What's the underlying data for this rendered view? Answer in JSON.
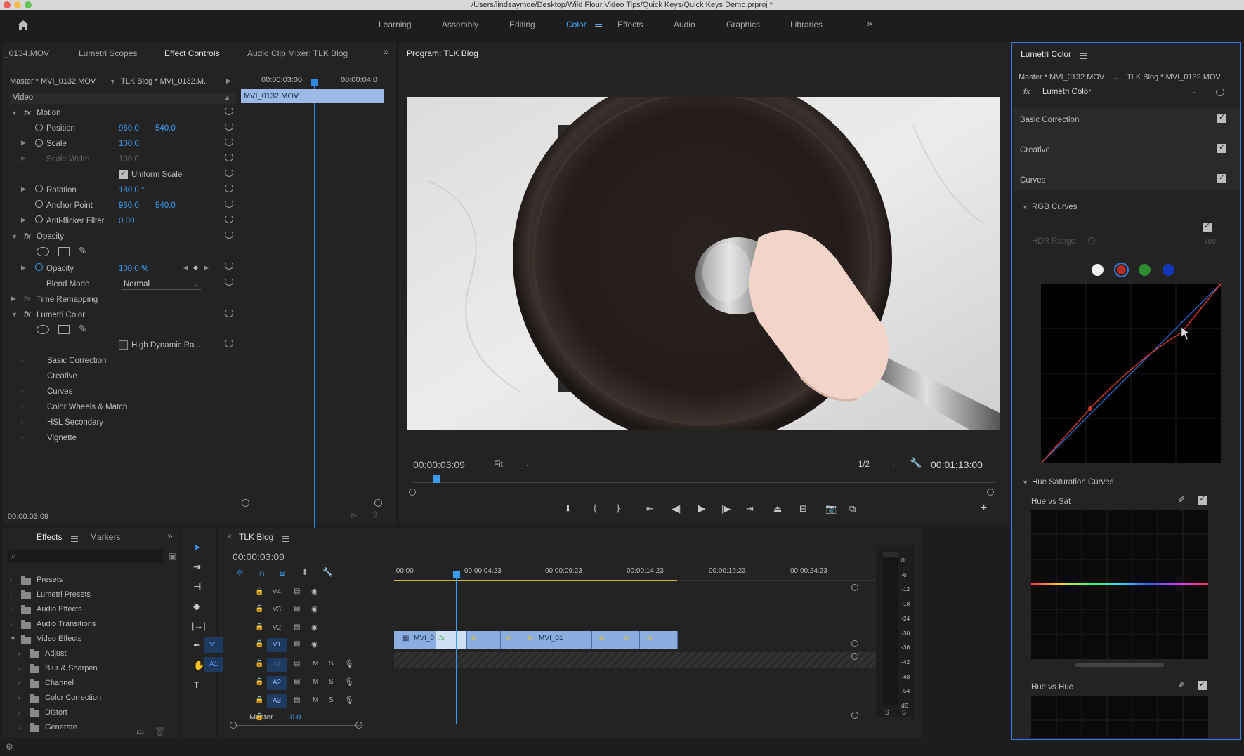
{
  "window_title": "/Users/lindsaymoe/Desktop/Wild Flour Video Tips/Quick Keys/Quick Keys Demo.prproj *",
  "workspaces": [
    "Learning",
    "Assembly",
    "Editing",
    "Color",
    "Effects",
    "Audio",
    "Graphics",
    "Libraries"
  ],
  "active_workspace": "Color",
  "source_panel": {
    "tabs": [
      "_0134.MOV",
      "Lumetri Scopes",
      "Effect Controls",
      "Audio Clip Mixer: TLK Blog"
    ],
    "master_label": "Master * MVI_0132.MOV",
    "sequence_label": "TLK Blog * MVI_0132.M...",
    "time_start": "00:00:03:00",
    "time_end": "00:00:04:0",
    "clip_name": "MVI_0132.MOV",
    "section": "Video",
    "motion": "Motion",
    "position_label": "Position",
    "position_x": "960.0",
    "position_y": "540.0",
    "scale_label": "Scale",
    "scale_val": "100.0",
    "scale_width_label": "Scale Width",
    "scale_width_val": "100.0",
    "uniform_scale": "Uniform Scale",
    "rotation_label": "Rotation",
    "rotation_val": "180.0 °",
    "anchor_label": "Anchor Point",
    "anchor_x": "960.0",
    "anchor_y": "540.0",
    "antiflicker_label": "Anti-flicker Filter",
    "antiflicker_val": "0.00",
    "opacity_group": "Opacity",
    "opacity_label": "Opacity",
    "opacity_val": "100.0 %",
    "blend_label": "Blend Mode",
    "blend_val": "Normal",
    "time_remap": "Time Remapping",
    "lumetri": "Lumetri Color",
    "hdr": "High Dynamic Ra...",
    "subsections": [
      "Basic Correction",
      "Creative",
      "Curves",
      "Color Wheels & Match",
      "HSL Secondary",
      "Vignette"
    ],
    "current_time": "00:00:03:09"
  },
  "program": {
    "title": "Program: TLK Blog",
    "timecode": "00:00:03:09",
    "fit": "Fit",
    "resolution": "1/2",
    "duration": "00:01:13:00"
  },
  "effects_panel": {
    "tabs": [
      "Effects",
      "Markers"
    ],
    "items": [
      {
        "label": "Presets",
        "level": 0
      },
      {
        "label": "Lumetri Presets",
        "level": 0
      },
      {
        "label": "Audio Effects",
        "level": 0
      },
      {
        "label": "Audio Transitions",
        "level": 0
      },
      {
        "label": "Video Effects",
        "level": 0
      },
      {
        "label": "Adjust",
        "level": 1
      },
      {
        "label": "Blur & Sharpen",
        "level": 1
      },
      {
        "label": "Channel",
        "level": 1
      },
      {
        "label": "Color Correction",
        "level": 1
      },
      {
        "label": "Distort",
        "level": 1
      },
      {
        "label": "Generate",
        "level": 1
      }
    ]
  },
  "timeline": {
    "title": "TLK Blog",
    "timecode": "00:00:03:09",
    "ruler": [
      ":00:00",
      "00:00:04:23",
      "00:00:09:23",
      "00:00:14:23",
      "00:00:19:23",
      "00:00:24:23"
    ],
    "tracks": [
      "V4",
      "V3",
      "V2",
      "V1",
      "A1",
      "A2",
      "A3"
    ],
    "master_label": "Master",
    "master_val": "0.0",
    "clip1": "MVI_0",
    "clip2": "MVI_01",
    "meter_labels": [
      "0",
      "-6",
      "-12",
      "-18",
      "-24",
      "-30",
      "-36",
      "-42",
      "-48",
      "-54",
      "dB"
    ]
  },
  "lumetri": {
    "title": "Lumetri Color",
    "master_label": "Master * MVI_0132.MOV",
    "sequence_label": "TLK Blog * MVI_0132.MOV",
    "effect": "Lumetri Color",
    "sections": [
      "Basic Correction",
      "Creative",
      "Curves"
    ],
    "rgb_curves": "RGB Curves",
    "hdr_range": "HDR Range",
    "hdr_val": "100",
    "hue_sat": "Hue Saturation Curves",
    "hue_vs_sat": "Hue vs Sat",
    "hue_vs_hue": "Hue vs Hue"
  }
}
